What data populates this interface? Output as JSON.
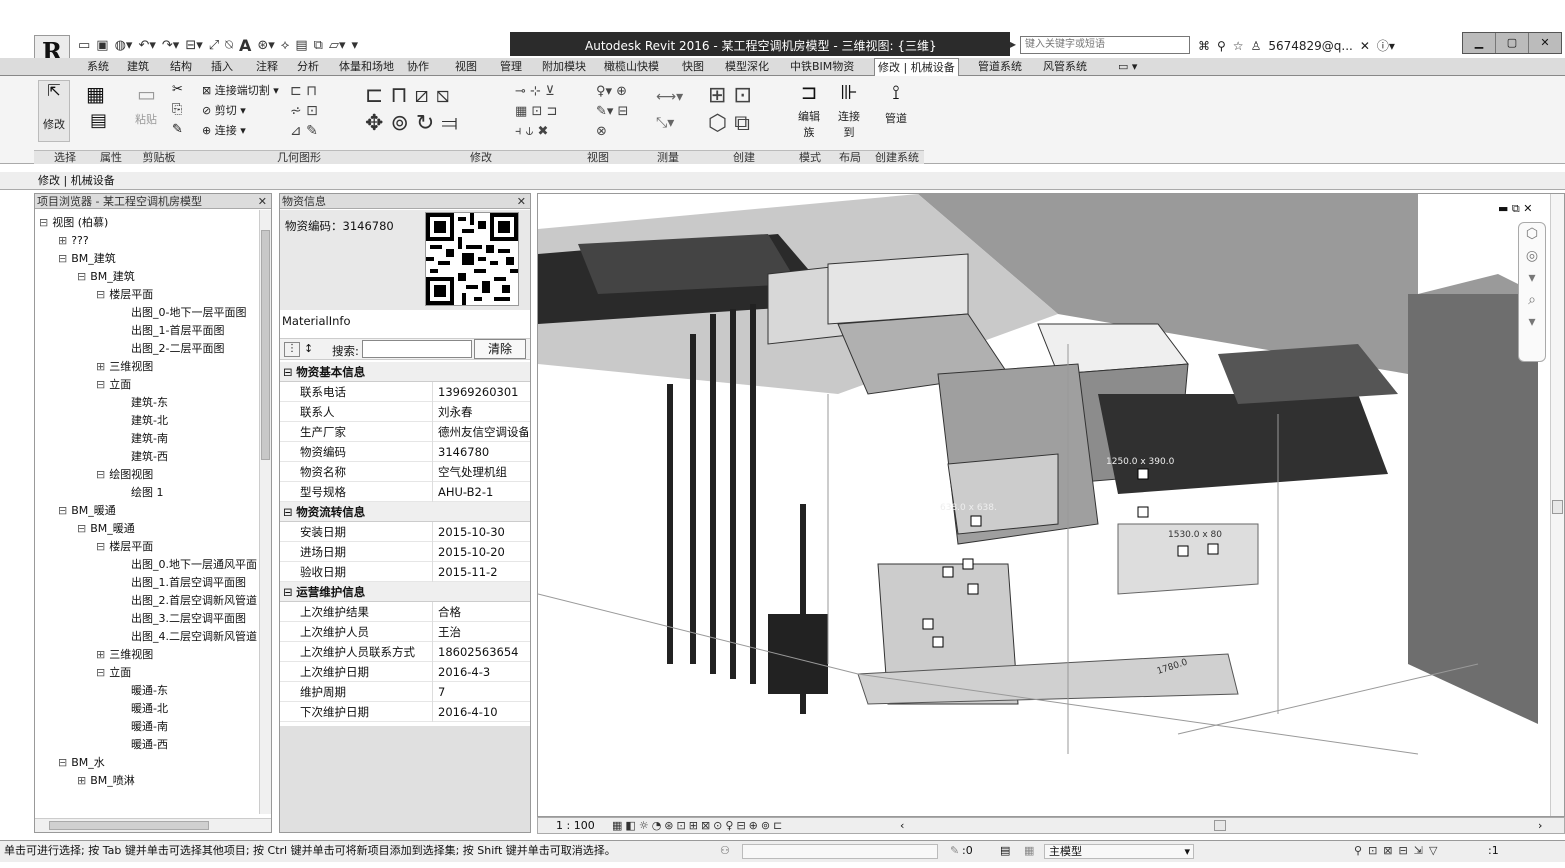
{
  "app": {
    "title": "Autodesk Revit 2016 -    某工程空调机房模型 - 三维视图: {三维}",
    "search_placeholder": "键入关键字或短语",
    "user": "5674829@q...",
    "logo": "R"
  },
  "tabs": [
    "系统",
    "建筑",
    "结构",
    "插入",
    "注释",
    "分析",
    "体量和场地",
    "协作",
    "视图",
    "管理",
    "附加模块",
    "橄榄山快模",
    "快图",
    "模型深化",
    "中铁BIM物资",
    "修改 | 机械设备",
    "管道系统",
    "风管系统"
  ],
  "active_tab": "修改 | 机械设备",
  "ribbon": {
    "modify_label": "修改",
    "copy_cut_label": "连接端切割",
    "cut_label": "剪切",
    "join_label": "连接",
    "paste_label": "粘贴",
    "edit_family_label": "编辑族",
    "connect_to_label": "连接到",
    "pipe_label": "管道",
    "panels": [
      "选择",
      "属性",
      "剪贴板",
      "几何图形",
      "修改",
      "视图",
      "测量",
      "创建",
      "模式",
      "布局",
      "创建系统"
    ]
  },
  "mode_bar": "修改 | 机械设备",
  "project_browser": {
    "header": "项目浏览器 - 某工程空调机房模型",
    "nodes": [
      {
        "text": "视图 (柏慕)",
        "level": 0,
        "sign": "⊟"
      },
      {
        "text": "???",
        "level": 1,
        "sign": "⊞"
      },
      {
        "text": "BM_建筑",
        "level": 1,
        "sign": "⊟"
      },
      {
        "text": "BM_建筑",
        "level": 2,
        "sign": "⊟"
      },
      {
        "text": "楼层平面",
        "level": 3,
        "sign": "⊟"
      },
      {
        "text": "出图_0-地下一层平面图",
        "level": 4,
        "sign": ""
      },
      {
        "text": "出图_1-首层平面图",
        "level": 4,
        "sign": ""
      },
      {
        "text": "出图_2-二层平面图",
        "level": 4,
        "sign": ""
      },
      {
        "text": "三维视图",
        "level": 3,
        "sign": "⊞"
      },
      {
        "text": "立面",
        "level": 3,
        "sign": "⊟"
      },
      {
        "text": "建筑-东",
        "level": 4,
        "sign": ""
      },
      {
        "text": "建筑-北",
        "level": 4,
        "sign": ""
      },
      {
        "text": "建筑-南",
        "level": 4,
        "sign": ""
      },
      {
        "text": "建筑-西",
        "level": 4,
        "sign": ""
      },
      {
        "text": "绘图视图",
        "level": 3,
        "sign": "⊟"
      },
      {
        "text": "绘图 1",
        "level": 4,
        "sign": ""
      },
      {
        "text": "BM_暖通",
        "level": 1,
        "sign": "⊟"
      },
      {
        "text": "BM_暖通",
        "level": 2,
        "sign": "⊟"
      },
      {
        "text": "楼层平面",
        "level": 3,
        "sign": "⊟"
      },
      {
        "text": "出图_0.地下一层通风平面",
        "level": 4,
        "sign": ""
      },
      {
        "text": "出图_1.首层空调平面图",
        "level": 4,
        "sign": ""
      },
      {
        "text": "出图_2.首层空调新风管道",
        "level": 4,
        "sign": ""
      },
      {
        "text": "出图_3.二层空调平面图",
        "level": 4,
        "sign": ""
      },
      {
        "text": "出图_4.二层空调新风管道",
        "level": 4,
        "sign": ""
      },
      {
        "text": "三维视图",
        "level": 3,
        "sign": "⊞"
      },
      {
        "text": "立面",
        "level": 3,
        "sign": "⊟"
      },
      {
        "text": "暖通-东",
        "level": 4,
        "sign": ""
      },
      {
        "text": "暖通-北",
        "level": 4,
        "sign": ""
      },
      {
        "text": "暖通-南",
        "level": 4,
        "sign": ""
      },
      {
        "text": "暖通-西",
        "level": 4,
        "sign": ""
      },
      {
        "text": "BM_水",
        "level": 1,
        "sign": "⊟"
      },
      {
        "text": "BM_喷淋",
        "level": 2,
        "sign": "⊞"
      }
    ]
  },
  "material_panel": {
    "header": "物资信息",
    "code_label": "物资编码：3146780",
    "info_title": "MaterialInfo",
    "search_label": "搜索:",
    "search_value": "",
    "clear_button": "清除",
    "groups": [
      {
        "title": "物资基本信息",
        "rows": [
          [
            "联系电话",
            "13969260301"
          ],
          [
            "联系人",
            "刘永春"
          ],
          [
            "生产厂家",
            "德州友信空调设备"
          ],
          [
            "物资编码",
            "3146780"
          ],
          [
            "物资名称",
            "空气处理机组"
          ],
          [
            "型号规格",
            "AHU-B2-1"
          ]
        ]
      },
      {
        "title": "物资流转信息",
        "rows": [
          [
            "安装日期",
            "2015-10-30"
          ],
          [
            "进场日期",
            "2015-10-20"
          ],
          [
            "验收日期",
            "2015-11-2"
          ]
        ]
      },
      {
        "title": "运营维护信息",
        "rows": [
          [
            "上次维护结果",
            "合格"
          ],
          [
            "上次维护人员",
            "王治"
          ],
          [
            "上次维护人员联系方式",
            "18602563654"
          ],
          [
            "上次维护日期",
            "2016-4-3"
          ],
          [
            "维护周期",
            "7"
          ],
          [
            "下次维护日期",
            "2016-4-10"
          ]
        ]
      }
    ]
  },
  "viewport": {
    "dim_labels": [
      "1250.0 x 390.0",
      "638.0 x 638.",
      "1530.0 x 80",
      "1780.0"
    ]
  },
  "view_control_bar": {
    "scale": "1 : 100"
  },
  "status": {
    "hint": "单击可进行选择; 按 Tab 键并单击可选择其他项目; 按 Ctrl 键并单击可将新项目添加到选择集; 按 Shift 键并单击可取消选择。",
    "counter": ":0",
    "model": "主模型",
    "filter_count": ":1"
  }
}
